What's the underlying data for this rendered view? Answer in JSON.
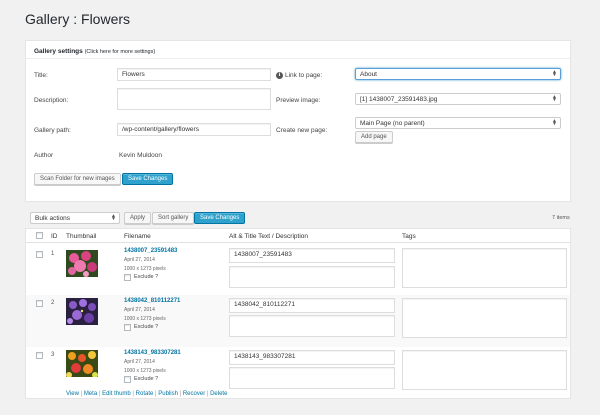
{
  "page": {
    "title": "Gallery : Flowers"
  },
  "settings": {
    "heading": "Gallery settings",
    "heading_note": "(Click here for more settings)",
    "title_label": "Title:",
    "title_value": "Flowers",
    "description_label": "Description:",
    "description_value": "",
    "path_label": "Gallery path:",
    "path_value": "/wp-content/gallery/flowers",
    "author_label": "Author",
    "author_value": "Kevin Muldoon",
    "link_label": "Link to page:",
    "link_value": "About",
    "preview_label": "Preview image:",
    "preview_value": "[1] 1438007_23591483.jpg",
    "create_label": "Create new page:",
    "create_value": "Main Page (no parent)",
    "add_page_label": "Add page",
    "scan_label": "Scan Folder for new images",
    "save_label": "Save Changes"
  },
  "toolbar": {
    "bulk_value": "Bulk actions",
    "apply_label": "Apply",
    "sort_label": "Sort gallery",
    "save_label": "Save Changes",
    "count": "7 items"
  },
  "table": {
    "headers": {
      "id": "ID",
      "thumbnail": "Thumbnail",
      "filename": "Filename",
      "alt": "Alt & Title Text / Description",
      "tags": "Tags"
    },
    "rows": [
      {
        "id": "1",
        "filename": "1438007_23591483",
        "date": "April 27, 2014",
        "size": "1000 x 1273 pixels",
        "exclude": "Exclude ?",
        "alt": "1438007_23591483",
        "thumb": "pink-flowers"
      },
      {
        "id": "2",
        "filename": "1438042_810112271",
        "date": "April 27, 2014",
        "size": "1000 x 1273 pixels",
        "exclude": "Exclude ?",
        "alt": "1438042_810112271",
        "thumb": "purple-flowers"
      },
      {
        "id": "3",
        "filename": "1438143_983307281",
        "date": "April 27, 2014",
        "size": "1000 x 1273 pixels",
        "exclude": "Exclude ?",
        "alt": "1438143_983307281",
        "thumb": "orange-flowers"
      }
    ],
    "row_actions": [
      "View",
      "Meta",
      "Edit thumb",
      "Rotate",
      "Publish",
      "Recover",
      "Delete"
    ]
  },
  "colors": {
    "accent": "#2ea2cc",
    "link": "#0074a2",
    "background": "#f1f1f1"
  }
}
